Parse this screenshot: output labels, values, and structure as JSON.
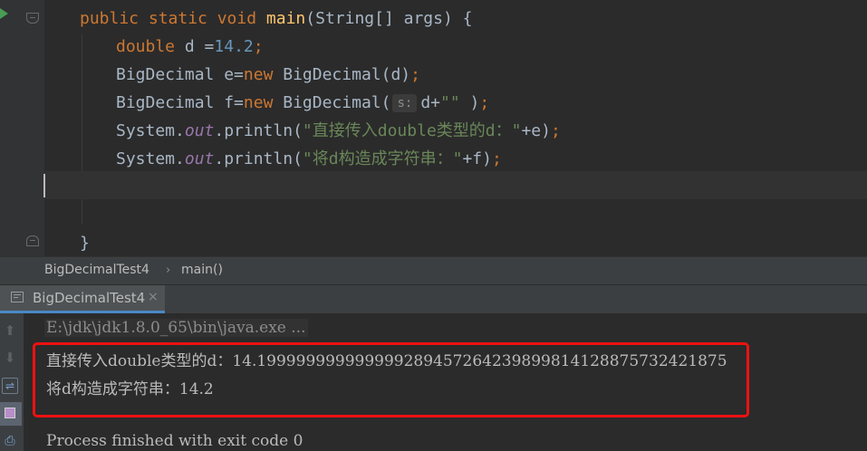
{
  "editor": {
    "line1": {
      "kw": "public static void ",
      "fn": "main",
      "rest": "(String[] args) {"
    },
    "line2": {
      "kw": "double",
      "mid": " d =",
      "num": "14.2",
      "end": ";"
    },
    "line3": {
      "a": "BigDecimal e=",
      "kw": "new",
      "b": " BigDecimal(d)",
      "end": ";"
    },
    "line4": {
      "a": "BigDecimal f=",
      "kw": "new",
      "b": " BigDecimal(",
      "hint": "s:",
      "c": "d+",
      "str": "\"\"",
      "d": " )",
      "end": ";"
    },
    "line5": {
      "a": "System.",
      "field": "out",
      "b": ".println(",
      "str": "\"直接传入double类型的d：\"",
      "c": "+e)",
      "end": ";"
    },
    "line6": {
      "a": "System.",
      "field": "out",
      "b": ".println(",
      "str": "\"将d构造成字符串：\"",
      "c": "+f)",
      "end": ";"
    },
    "line9": "}"
  },
  "breadcrumb": {
    "class_name": "BigDecimalTest4",
    "separator": "›",
    "method": "main()"
  },
  "run_tab": {
    "label": "BigDecimalTest4",
    "close": "×"
  },
  "console": {
    "command": "E:\\jdk\\jdk1.8.0_65\\bin\\java.exe ...",
    "output1": "直接传入double类型的d：14.199999999999999289457264239899814128875732421875",
    "output2": "将d构造成字符串：14.2",
    "exit": "Process finished with exit code 0"
  },
  "colors": {
    "annotation_box": "#ee1111",
    "keyword": "#cc7832",
    "method": "#ffc66d",
    "number": "#6897bb",
    "string": "#6a8759",
    "field": "#9876aa"
  },
  "icons": [
    "run-gutter-icon",
    "fold-icon",
    "console-tab-icon",
    "close-icon",
    "arrow-up-icon",
    "arrow-down-icon",
    "soft-wrap-icon",
    "scroll-to-end-icon",
    "print-icon"
  ]
}
